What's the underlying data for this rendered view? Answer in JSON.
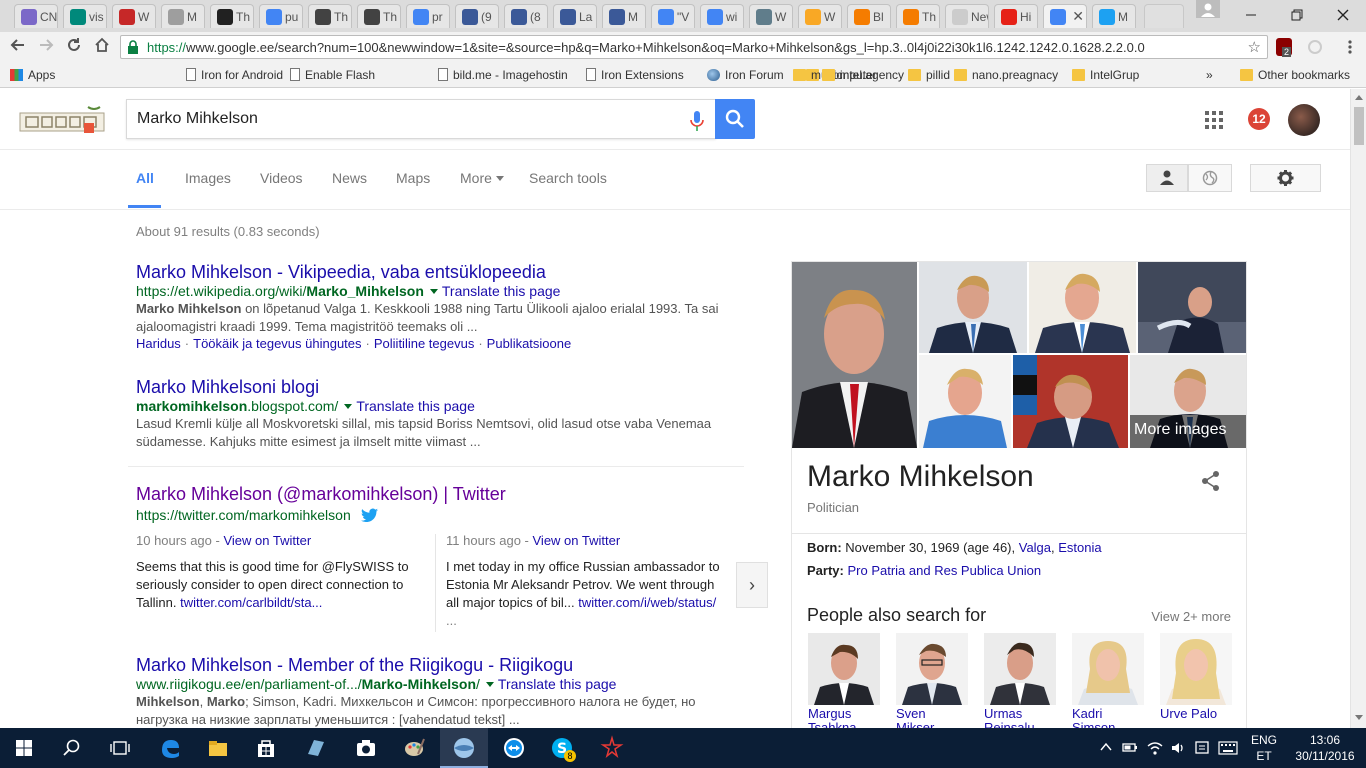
{
  "browser": {
    "tabs": [
      {
        "title": "CN",
        "color": "#7b68c8"
      },
      {
        "title": "vis",
        "color": "#00897b"
      },
      {
        "title": "W",
        "color": "#c62828"
      },
      {
        "title": "M",
        "color": "#9e9e9e"
      },
      {
        "title": "Th",
        "color": "#212121"
      },
      {
        "title": "pu",
        "color": "#4285f4"
      },
      {
        "title": "Th",
        "color": "#424242"
      },
      {
        "title": "Th",
        "color": "#424242"
      },
      {
        "title": "pr",
        "color": "#4285f4"
      },
      {
        "title": "(9",
        "color": "#3b5998"
      },
      {
        "title": "(8",
        "color": "#3b5998"
      },
      {
        "title": "La",
        "color": "#3b5998"
      },
      {
        "title": "M",
        "color": "#3b5998"
      },
      {
        "title": "\"V",
        "color": "#4285f4"
      },
      {
        "title": "wi",
        "color": "#4285f4"
      },
      {
        "title": "W",
        "color": "#607d8b"
      },
      {
        "title": "W",
        "color": "#f9a825"
      },
      {
        "title": "Bl",
        "color": "#f57c00"
      },
      {
        "title": "Th",
        "color": "#f57c00"
      },
      {
        "title": "New T",
        "color": "#cccccc"
      },
      {
        "title": "Hi",
        "color": "#e62117"
      },
      {
        "title": "M",
        "color": "#4285f4"
      },
      {
        "title": "M",
        "color": "#1da1f2"
      }
    ],
    "active_tab_close": "✕",
    "url_scheme": "https://",
    "url_rest": "www.google.ee/search?num=100&newwindow=1&site=&source=hp&q=Marko+Mihkelson&oq=Marko+Mihkelson&gs_l=hp.3..0l4j0i22i30k1l6.1242.1242.0.1628.2.2.0.0",
    "ext_badge": "2",
    "bookmarks": [
      {
        "label": "Apps",
        "type": "apps"
      },
      {
        "label": "Iron for Android",
        "type": "page"
      },
      {
        "label": "Enable Flash",
        "type": "page"
      },
      {
        "label": "bild.me - Imagehostin",
        "type": "page"
      },
      {
        "label": "Iron Extensions",
        "type": "page"
      },
      {
        "label": "Iron Forum",
        "type": "globe"
      },
      {
        "label": "Computer",
        "type": "folder"
      },
      {
        "label": "pillid",
        "type": "folder"
      },
      {
        "label": "music",
        "type": "folder"
      },
      {
        "label": "intel.agency",
        "type": "folder"
      },
      {
        "label": "nano.preagnacy",
        "type": "folder"
      },
      {
        "label": "IntelGrup",
        "type": "folder"
      }
    ],
    "bookmarks_overflow": "»",
    "other_bookmarks": "Other bookmarks"
  },
  "search": {
    "query": "Marko Mihkelson",
    "notification_count": "12",
    "tabs": [
      "All",
      "Images",
      "Videos",
      "News",
      "Maps",
      "More",
      "Search tools"
    ],
    "stats": "About 91 results (0.83 seconds)"
  },
  "results": [
    {
      "title": "Marko Mihkelson - Vikipeedia, vaba entsüklopeedia",
      "url_pre": "https://et.wikipedia.org/wiki/",
      "url_bold": "Marko_Mihkelson",
      "url_post": "",
      "translate": "Translate this page",
      "snippet_bold": "Marko Mihkelson",
      "snippet_line1": " on lõpetanud Valga 1. Keskkooli 1988 ning Tartu Ülikooli ajaloo erialal 1993. Ta sai",
      "snippet_line2": "ajaloomagistri kraadi 1999. Tema magistritöö teemaks oli ...",
      "sitelinks": [
        "Haridus",
        "Töökäik ja tegevus ühingutes",
        "Poliitiline tegevus",
        "Publikatsioone"
      ]
    },
    {
      "title": "Marko Mihkelsoni blogi",
      "url_bold": "markomihkelson",
      "url_post": ".blogspot.com/",
      "translate": "Translate this page",
      "snippet_line1": "Lasud Kremli külje all Moskvoretski sillal, mis tapsid Boriss Nemtsovi, olid lasud otse vaba Venemaa",
      "snippet_line2": "südamesse. Kahjuks mitte esimest ja ilmselt mitte viimast ..."
    },
    {
      "title": "Marko Mihkelson (@markomihkelson) | Twitter",
      "url": "https://twitter.com/markomihkelson",
      "tweets": [
        {
          "time": "10 hours ago",
          "sep": " - ",
          "view": "View on Twitter",
          "line1": "Seems that this is good time for @FlySWISS to",
          "line2": "seriously consider to open direct connection to",
          "line3_text": "Tallinn. ",
          "line3_link": "twitter.com/carlbildt/sta..."
        },
        {
          "time": "11 hours ago",
          "sep": " - ",
          "view": "View on Twitter",
          "line1": "I met today in my office Russian ambassador to",
          "line2": "Estonia Mr Aleksandr Petrov. We went through",
          "line3_text": "all major topics of bil... ",
          "line3_link": "twitter.com/i/web/status/",
          "line4": "..."
        }
      ],
      "next": "›"
    },
    {
      "title": "Marko Mihkelson - Member of the Riigikogu - Riigikogu",
      "url_pre": "www.riigikogu.ee/en/parliament-of.../",
      "url_bold": "Marko-Mihkelson",
      "url_post": "/",
      "translate": "Translate this page",
      "snippet_bold1": "Mihkelson",
      "snippet_sep": ", ",
      "snippet_bold2": "Marko",
      "snippet_line1": "; Simson, Kadri. Михкельсон и Симсон: прогрессивного налога не будет, но",
      "snippet_line2": "нагрузка на низкие зарплаты уменьшится : [vahendatud tekst] ..."
    }
  ],
  "knowledge_panel": {
    "more_images": "More images",
    "name": "Marko Mihkelson",
    "subtitle": "Politician",
    "born_label": "Born:",
    "born_value": " November 30, 1969 (age 46), ",
    "born_place1": "Valga",
    "born_comma": ", ",
    "born_place2": "Estonia",
    "party_label": "Party:",
    "party_value": "Pro Patria and Res Publica Union",
    "people_heading": "People also search for",
    "view_more": "View 2+ more",
    "people": [
      {
        "line1": "Margus",
        "line2": "Tsahkna"
      },
      {
        "line1": "Sven",
        "line2": "Mikser"
      },
      {
        "line1": "Urmas",
        "line2": "Reinsalu"
      },
      {
        "line1": "Kadri",
        "line2": "Simson"
      },
      {
        "line1": "Urve Palo",
        "line2": ""
      }
    ]
  },
  "taskbar": {
    "lang1": "ENG",
    "lang2": "ET",
    "time": "13:06",
    "date": "30/11/2016",
    "skype_badge": "8"
  }
}
